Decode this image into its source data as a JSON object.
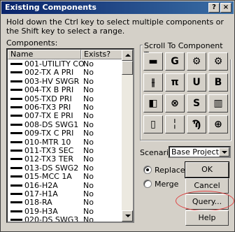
{
  "window": {
    "title": "Existing Components",
    "help_glyph": "?",
    "close_glyph": "×"
  },
  "instructions": "Hold down the Ctrl key to select multiple components or the Shift key to select a range.",
  "components_label": "Components:",
  "list": {
    "columns": [
      "Name",
      "Exists?"
    ],
    "rows": [
      {
        "name": "001-UTILITY CO",
        "exists": "No"
      },
      {
        "name": "002-TX A PRI",
        "exists": "No"
      },
      {
        "name": "003-HV SWGR",
        "exists": "No"
      },
      {
        "name": "004-TX B PRI",
        "exists": "No"
      },
      {
        "name": "005-TXD PRI",
        "exists": "No"
      },
      {
        "name": "006-TX3 PRI",
        "exists": "No"
      },
      {
        "name": "007-TX E PRI",
        "exists": "No"
      },
      {
        "name": "008-DS SWG1",
        "exists": "No"
      },
      {
        "name": "009-TX C PRI",
        "exists": "No"
      },
      {
        "name": "010-MTR 10",
        "exists": "No"
      },
      {
        "name": "011-TX3 SEC",
        "exists": "No"
      },
      {
        "name": "012-TX3 TER",
        "exists": "No"
      },
      {
        "name": "013-DS SWG2",
        "exists": "No"
      },
      {
        "name": "015-MCC 1A",
        "exists": "No"
      },
      {
        "name": "016-H2A",
        "exists": "No"
      },
      {
        "name": "017-H1A",
        "exists": "No"
      },
      {
        "name": "018-RA",
        "exists": "No"
      },
      {
        "name": "019-H3A",
        "exists": "No"
      },
      {
        "name": "020-DS SWG3",
        "exists": "No"
      }
    ]
  },
  "scroll_group": {
    "title": "Scroll To Component Type",
    "buttons": [
      {
        "icon": "busbar-icon",
        "glyph": "▬"
      },
      {
        "icon": "generator-icon",
        "glyph": "G"
      },
      {
        "icon": "motor-group-icon",
        "glyph": "⚙"
      },
      {
        "icon": "load-group-icon",
        "glyph": "⚙"
      },
      {
        "icon": "transformer-icon",
        "glyph": "⫲"
      },
      {
        "icon": "cable-icon",
        "glyph": "π"
      },
      {
        "icon": "utility-icon",
        "glyph": "U"
      },
      {
        "icon": "breaker-icon",
        "glyph": "B"
      },
      {
        "icon": "panel-icon",
        "glyph": "◧"
      },
      {
        "icon": "relay-icon",
        "glyph": "⊗"
      },
      {
        "icon": "switch-icon",
        "glyph": "S"
      },
      {
        "icon": "capacitor-icon",
        "glyph": "▥"
      },
      {
        "icon": "fuse-icon",
        "glyph": "▯"
      },
      {
        "icon": "disconnect-icon",
        "glyph": "╎"
      },
      {
        "icon": "reactor-icon",
        "glyph": "Ϡ"
      },
      {
        "icon": "filter-icon",
        "glyph": "⊕"
      }
    ]
  },
  "scenario": {
    "label": "Scenario:",
    "value": "Base Project"
  },
  "mode": {
    "replace": "Replace",
    "merge": "Merge",
    "selected": "Replace"
  },
  "buttons": {
    "ok": "OK",
    "cancel": "Cancel",
    "query": "Query...",
    "help": "Help"
  }
}
